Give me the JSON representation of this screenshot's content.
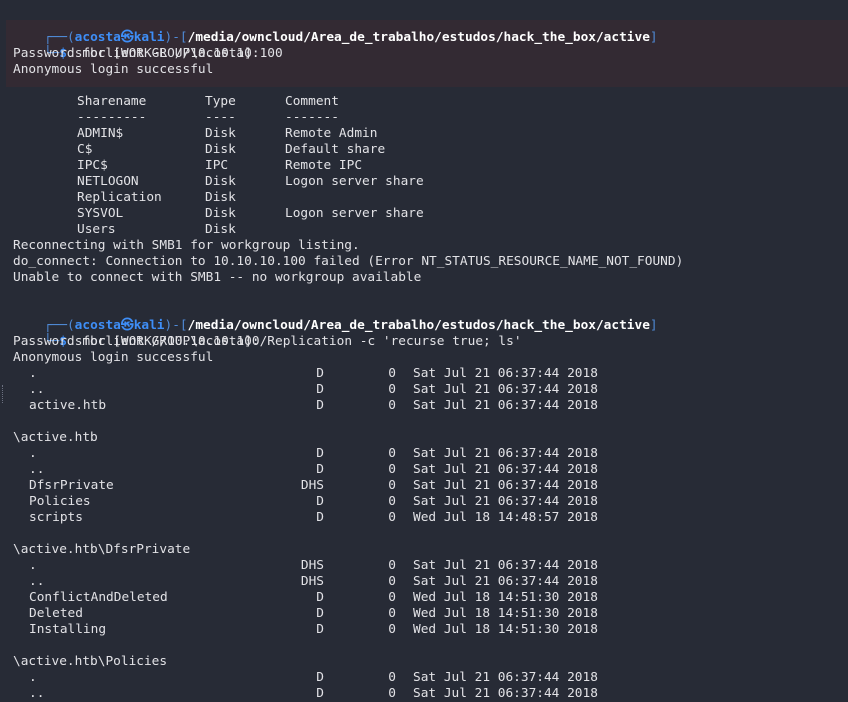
{
  "prompt": {
    "user": "acosta",
    "host": "kali",
    "path": "/media/owncloud/Area_de_trabalho/estudos/hack_the_box/active",
    "symbol": "$"
  },
  "commands": {
    "c1": "smbclient -L //10.10.10.100",
    "c2": "smbclient //10.10.10.100/Replication -c 'recurse true; ls'"
  },
  "lines": {
    "password": "Password for [WORKGROUP\\acosta]:",
    "anon": "Anonymous login successful",
    "reconnect": "Reconnecting with SMB1 for workgroup listing.",
    "doconnect": "do_connect: Connection to 10.10.10.100 failed (Error NT_STATUS_RESOURCE_NAME_NOT_FOUND)",
    "unable": "Unable to connect with SMB1 -- no workgroup available"
  },
  "share_headers": {
    "name": "Sharename",
    "type": "Type",
    "comment": "Comment",
    "u_name": "---------",
    "u_type": "----",
    "u_comment": "-------"
  },
  "shares": [
    {
      "name": "ADMIN$",
      "type": "Disk",
      "comment": "Remote Admin"
    },
    {
      "name": "C$",
      "type": "Disk",
      "comment": "Default share"
    },
    {
      "name": "IPC$",
      "type": "IPC",
      "comment": "Remote IPC"
    },
    {
      "name": "NETLOGON",
      "type": "Disk",
      "comment": "Logon server share"
    },
    {
      "name": "Replication",
      "type": "Disk",
      "comment": ""
    },
    {
      "name": "SYSVOL",
      "type": "Disk",
      "comment": "Logon server share"
    },
    {
      "name": "Users",
      "type": "Disk",
      "comment": ""
    }
  ],
  "listing": [
    {
      "kind": "entry",
      "name": ".",
      "attr": "D",
      "size": "0",
      "date": "Sat Jul 21 06:37:44 2018"
    },
    {
      "kind": "entry",
      "name": "..",
      "attr": "D",
      "size": "0",
      "date": "Sat Jul 21 06:37:44 2018"
    },
    {
      "kind": "entry",
      "name": "active.htb",
      "attr": "D",
      "size": "0",
      "date": "Sat Jul 21 06:37:44 2018"
    },
    {
      "kind": "blank"
    },
    {
      "kind": "dir",
      "name": "\\active.htb"
    },
    {
      "kind": "entry",
      "name": ".",
      "attr": "D",
      "size": "0",
      "date": "Sat Jul 21 06:37:44 2018"
    },
    {
      "kind": "entry",
      "name": "..",
      "attr": "D",
      "size": "0",
      "date": "Sat Jul 21 06:37:44 2018"
    },
    {
      "kind": "entry",
      "name": "DfsrPrivate",
      "attr": "DHS",
      "size": "0",
      "date": "Sat Jul 21 06:37:44 2018"
    },
    {
      "kind": "entry",
      "name": "Policies",
      "attr": "D",
      "size": "0",
      "date": "Sat Jul 21 06:37:44 2018"
    },
    {
      "kind": "entry",
      "name": "scripts",
      "attr": "D",
      "size": "0",
      "date": "Wed Jul 18 14:48:57 2018"
    },
    {
      "kind": "blank"
    },
    {
      "kind": "dir",
      "name": "\\active.htb\\DfsrPrivate"
    },
    {
      "kind": "entry",
      "name": ".",
      "attr": "DHS",
      "size": "0",
      "date": "Sat Jul 21 06:37:44 2018"
    },
    {
      "kind": "entry",
      "name": "..",
      "attr": "DHS",
      "size": "0",
      "date": "Sat Jul 21 06:37:44 2018"
    },
    {
      "kind": "entry",
      "name": "ConflictAndDeleted",
      "attr": "D",
      "size": "0",
      "date": "Wed Jul 18 14:51:30 2018"
    },
    {
      "kind": "entry",
      "name": "Deleted",
      "attr": "D",
      "size": "0",
      "date": "Wed Jul 18 14:51:30 2018"
    },
    {
      "kind": "entry",
      "name": "Installing",
      "attr": "D",
      "size": "0",
      "date": "Wed Jul 18 14:51:30 2018"
    },
    {
      "kind": "blank"
    },
    {
      "kind": "dir",
      "name": "\\active.htb\\Policies"
    },
    {
      "kind": "entry",
      "name": ".",
      "attr": "D",
      "size": "0",
      "date": "Sat Jul 21 06:37:44 2018"
    },
    {
      "kind": "entry",
      "name": "..",
      "attr": "D",
      "size": "0",
      "date": "Sat Jul 21 06:37:44 2018"
    }
  ]
}
